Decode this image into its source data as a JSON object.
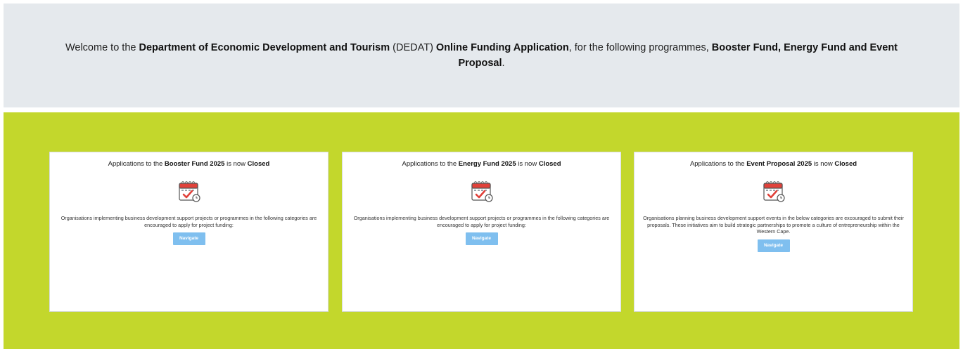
{
  "banner": {
    "pre": "Welcome to the ",
    "org": "Department of Economic Development and Tourism",
    "abbr": " (DEDAT) ",
    "app": "Online Funding Application",
    "mid": ", for the following programmes, ",
    "programmes": "Booster Fund, Energy Fund and Event Proposal",
    "end": "."
  },
  "cards": [
    {
      "title_pre": "Applications to the ",
      "fund": "Booster Fund 2025",
      "title_mid": " is now ",
      "status": "Closed",
      "description": "Organisations implementing business development support projects or programmes in the following categories are encouraged to apply for project funding:",
      "button": "Navigate",
      "icon": "calendar-check-icon"
    },
    {
      "title_pre": "Applications to the ",
      "fund": "Energy Fund 2025",
      "title_mid": " is now ",
      "status": "Closed",
      "description": "Organisations implementing business development support projects or programmes in the following categories are encouraged to apply for project funding:",
      "button": "Navigate",
      "icon": "calendar-check-icon"
    },
    {
      "title_pre": "Applications to the ",
      "fund": "Event Proposal 2025",
      "title_mid": " is now ",
      "status": "Closed",
      "description": "Organisations planning business development support events in the below categories are excouraged to submit their proposals. These initiatives aim to build strategic partnerships to promote a culture of entrepreneurship within the Western Cape.",
      "button": "Navigate",
      "icon": "calendar-check-icon"
    }
  ],
  "colors": {
    "banner_bg": "#e5e9ed",
    "section_bg": "#c3d72c",
    "button_bg": "#7fbfef",
    "calendar_red": "#e0413a"
  }
}
